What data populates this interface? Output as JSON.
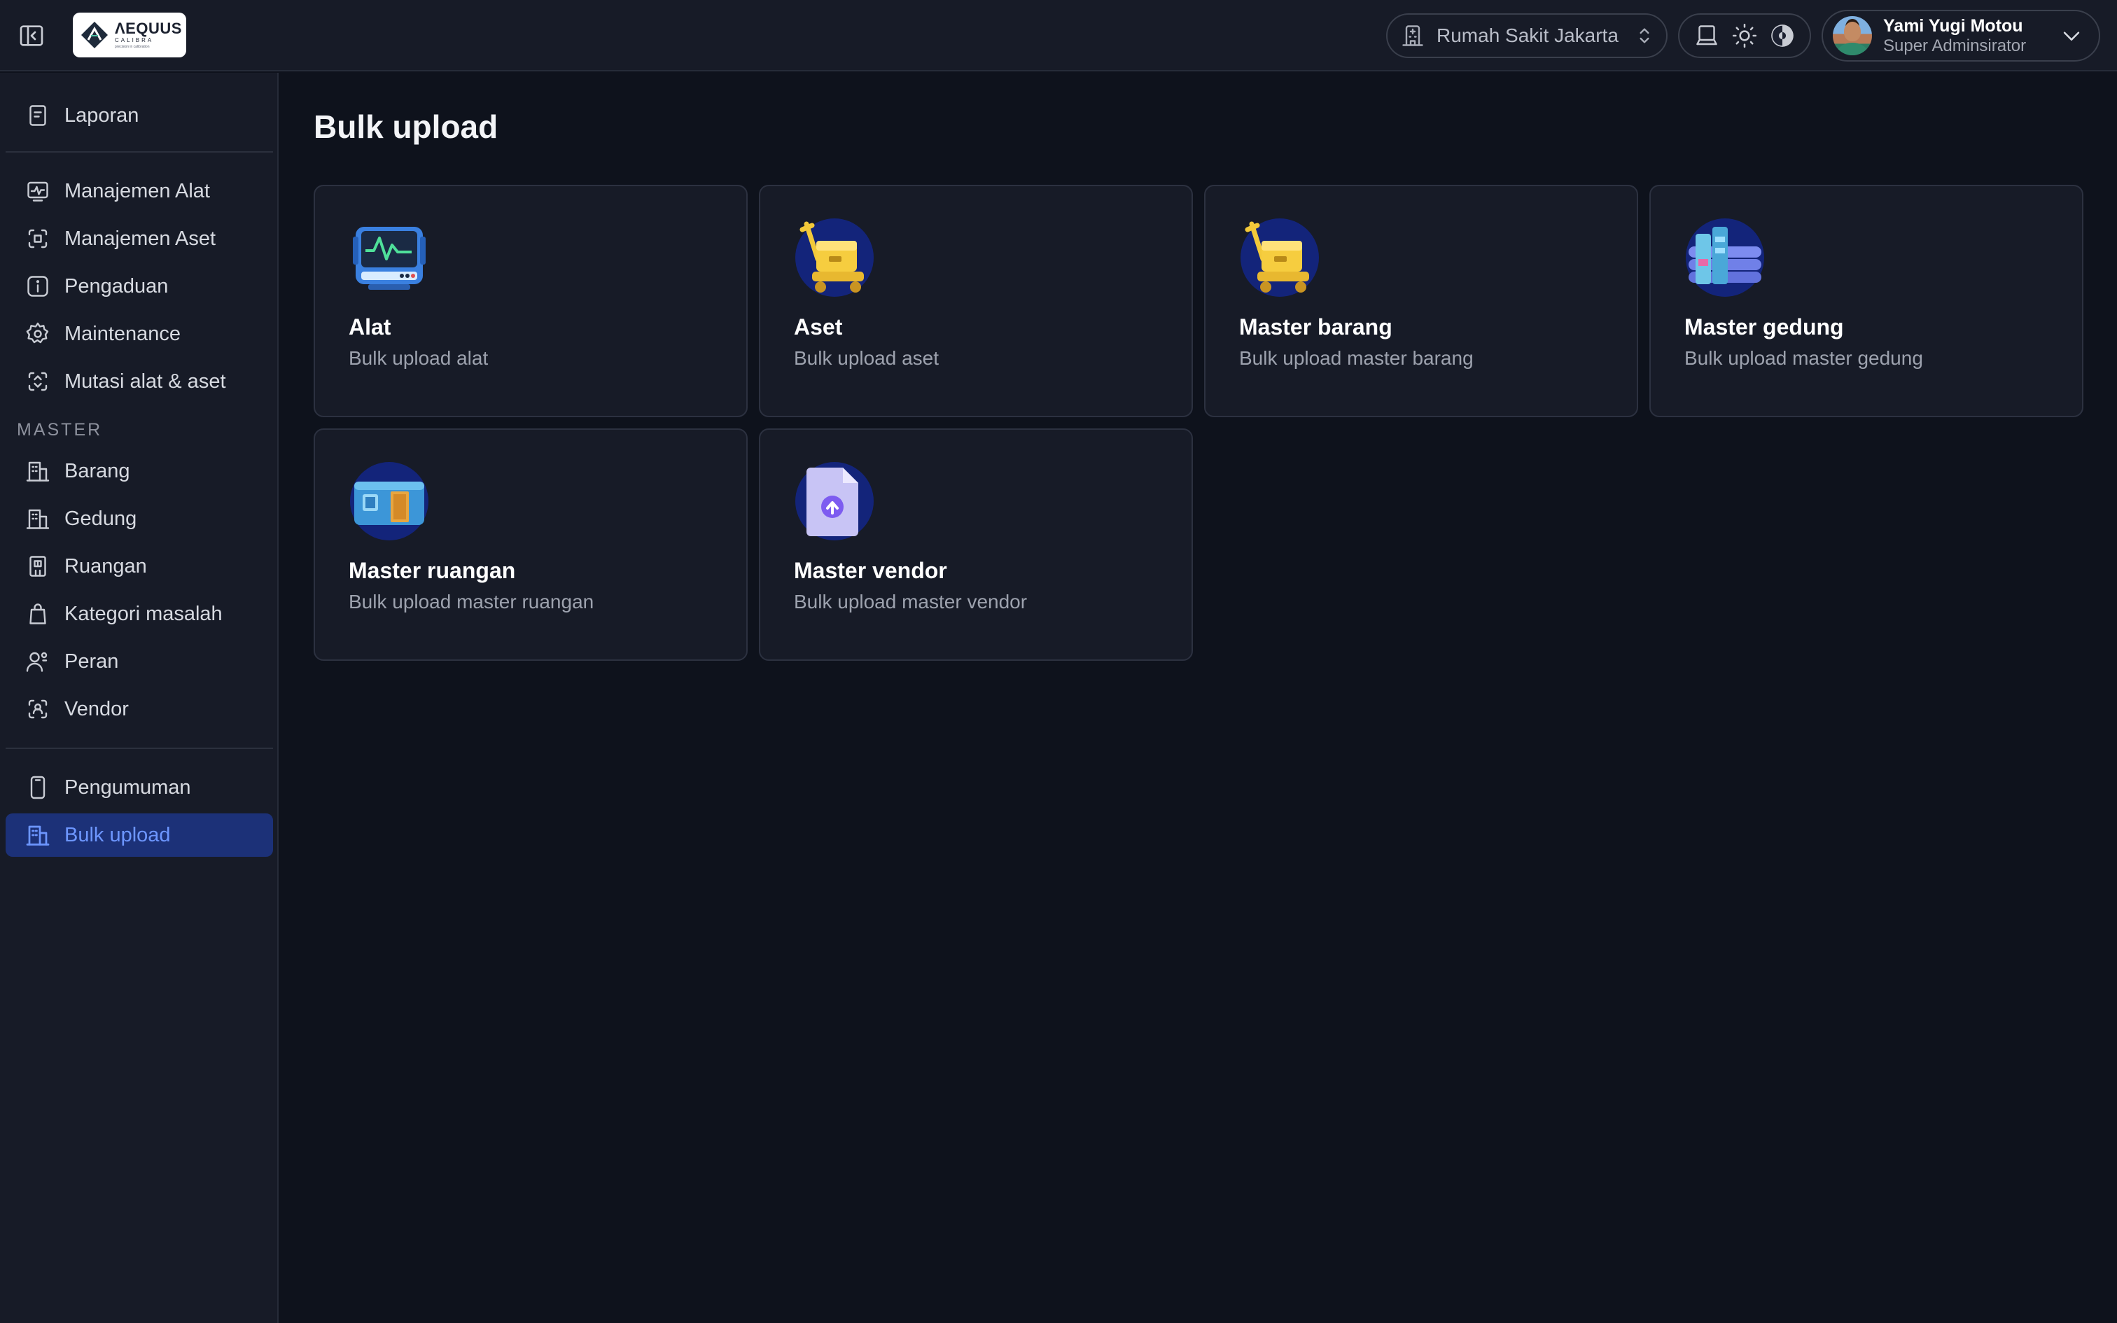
{
  "brand": {
    "name": "ΛEQUUS",
    "sub": "CALIBRA",
    "tagline": "precision in calibration"
  },
  "header": {
    "hospital": "Rumah Sakit Jakarta",
    "user": {
      "name": "Yami Yugi Motou",
      "role": "Super Adminsirator"
    }
  },
  "sidebar": {
    "top_items": [
      {
        "label": "Laporan",
        "icon": "report-icon"
      }
    ],
    "main_items": [
      {
        "label": "Manajemen Alat",
        "icon": "monitor-icon"
      },
      {
        "label": "Manajemen Aset",
        "icon": "asset-icon"
      },
      {
        "label": "Pengaduan",
        "icon": "info-icon"
      },
      {
        "label": "Maintenance",
        "icon": "gear-icon"
      },
      {
        "label": "Mutasi alat & aset",
        "icon": "transfer-icon"
      }
    ],
    "master_section_label": "MASTER",
    "master_items": [
      {
        "label": "Barang",
        "icon": "building-icon"
      },
      {
        "label": "Gedung",
        "icon": "building-icon"
      },
      {
        "label": "Ruangan",
        "icon": "room-icon"
      },
      {
        "label": "Kategori masalah",
        "icon": "bag-icon"
      },
      {
        "label": "Peran",
        "icon": "users-icon"
      },
      {
        "label": "Vendor",
        "icon": "vendor-icon"
      }
    ],
    "bottom_items": [
      {
        "label": "Pengumuman",
        "icon": "phone-icon"
      },
      {
        "label": "Bulk upload",
        "icon": "building-icon",
        "active": true
      }
    ]
  },
  "main": {
    "title": "Bulk upload",
    "cards": [
      {
        "title": "Alat",
        "desc": "Bulk upload alat",
        "icon": "monitor-device-icon"
      },
      {
        "title": "Aset",
        "desc": "Bulk upload aset",
        "icon": "hand-truck-icon"
      },
      {
        "title": "Master barang",
        "desc": "Bulk upload master barang",
        "icon": "hand-truck-icon"
      },
      {
        "title": "Master gedung",
        "desc": "Bulk upload master gedung",
        "icon": "buildings-icon"
      },
      {
        "title": "Master ruangan",
        "desc": "Bulk upload master ruangan",
        "icon": "room-door-icon"
      },
      {
        "title": "Master vendor",
        "desc": "Bulk upload master vendor",
        "icon": "file-upload-icon"
      }
    ]
  },
  "colors": {
    "accent": "#6d96ff",
    "active_bg": "#1c3178",
    "bg": "#0e121c",
    "panel": "#171b27"
  }
}
